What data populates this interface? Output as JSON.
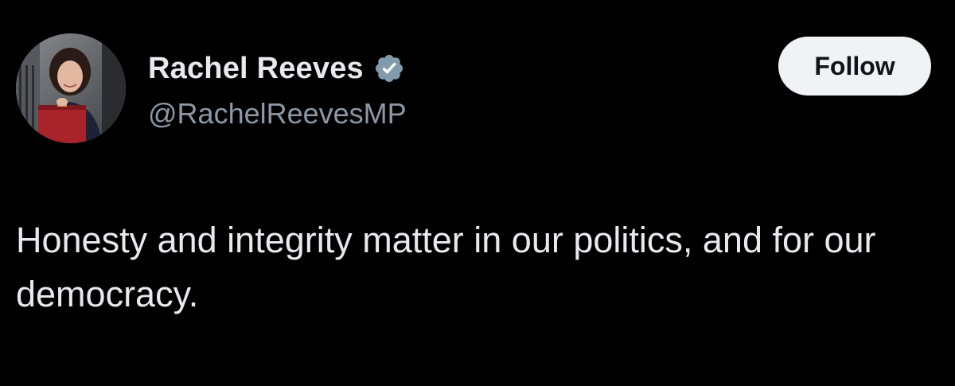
{
  "author": {
    "display_name": "Rachel Reeves",
    "handle": "@RachelReevesMP",
    "verified": true,
    "verified_badge_color": "#829aab",
    "avatar": "profile-photo"
  },
  "actions": {
    "follow_label": "Follow"
  },
  "tweet": {
    "text": "Honesty and integrity matter in our politics, and for our democracy."
  },
  "colors": {
    "background": "#000000",
    "primary_text": "#e7e9ea",
    "secondary_text": "#8b98a5",
    "follow_button_bg": "#eff3f4",
    "follow_button_text": "#0f1419"
  }
}
